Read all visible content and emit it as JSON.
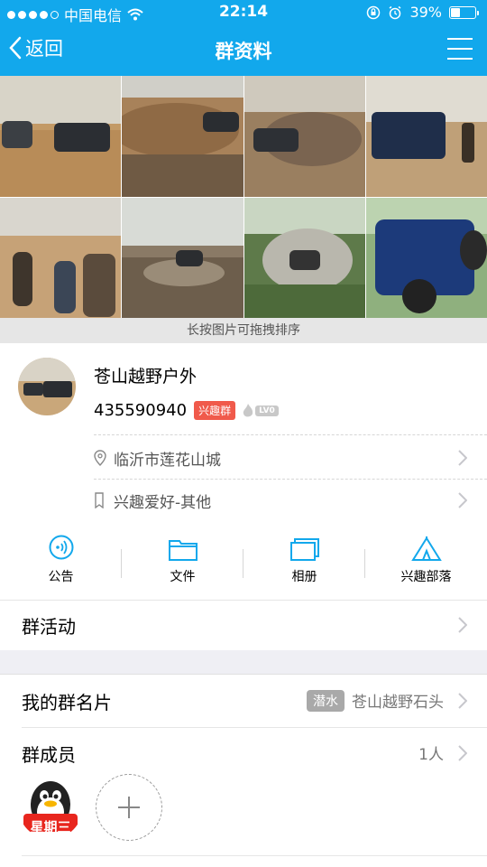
{
  "status_bar": {
    "carrier": "中国电信",
    "time": "22:14",
    "battery": "39%",
    "battery_level": 0.39
  },
  "nav": {
    "back_label": "返回",
    "title": "群资料"
  },
  "photos": {
    "hint": "长按图片可拖拽排序"
  },
  "group": {
    "name": "苍山越野户外",
    "id": "435590940",
    "type_tag": "兴趣群",
    "level": "LV0",
    "location": "临沂市莲花山城",
    "category": "兴趣爱好-其他"
  },
  "actions": [
    {
      "label": "公告"
    },
    {
      "label": "文件"
    },
    {
      "label": "相册"
    },
    {
      "label": "兴趣部落"
    }
  ],
  "group_activity_label": "群活动",
  "my_card": {
    "label": "我的群名片",
    "tag": "潜水",
    "value": "苍山越野石头"
  },
  "members": {
    "label": "群成员",
    "count": "1人",
    "avatar_text": "星期三"
  },
  "colors": {
    "brand": "#12a8ec",
    "red_tag": "#f05a4b"
  }
}
